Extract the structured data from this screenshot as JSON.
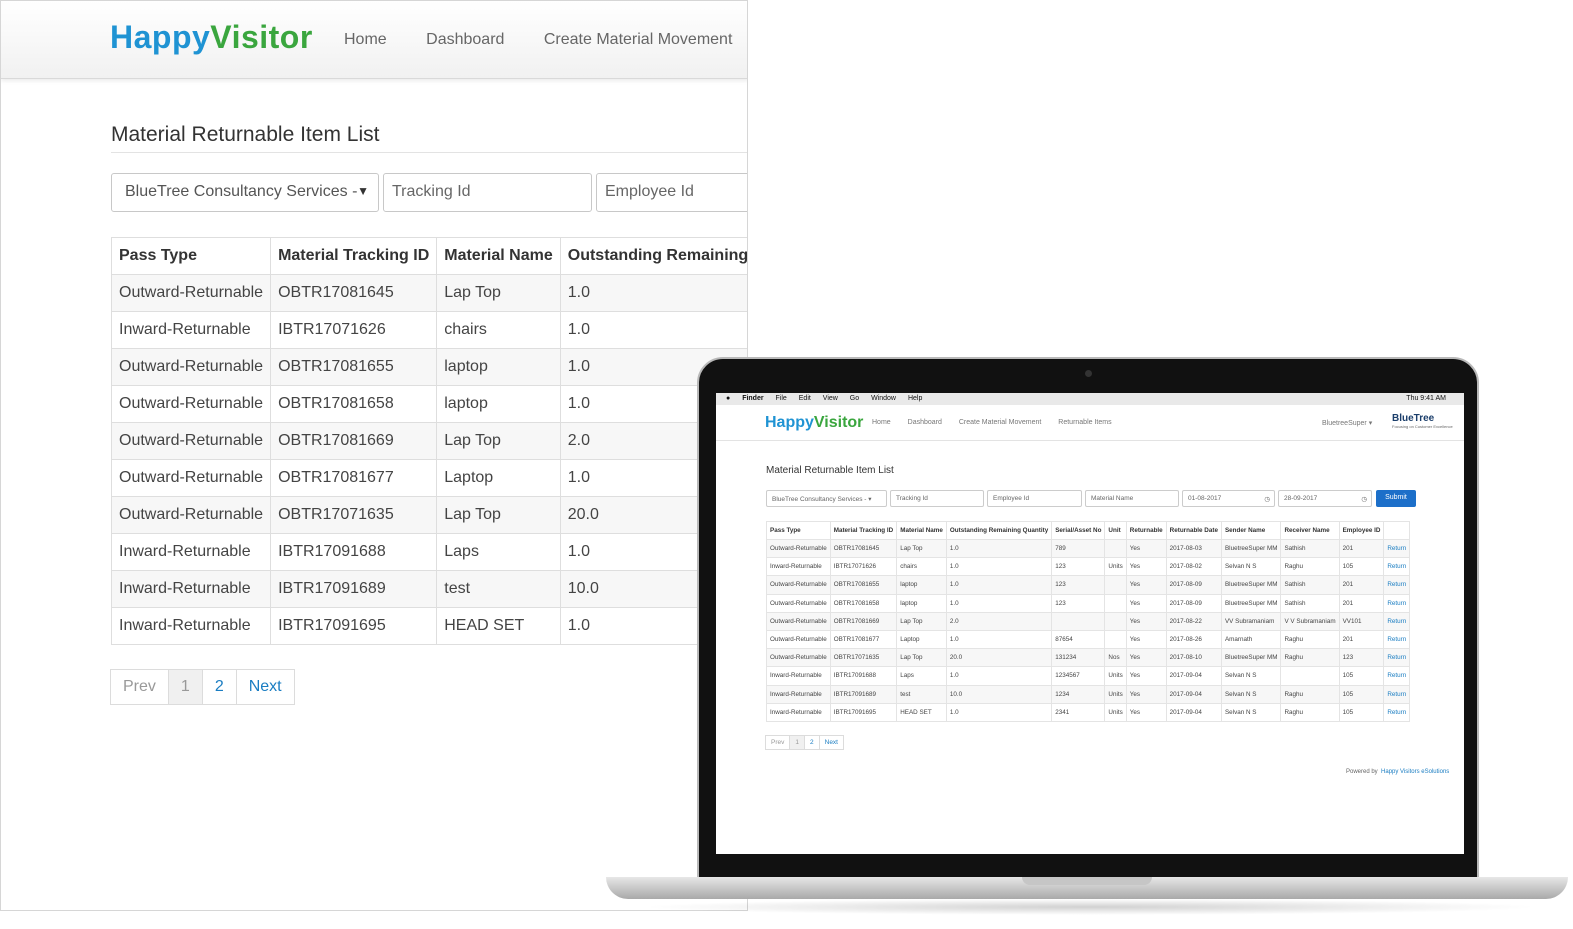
{
  "app": {
    "logo_part1": "Happy",
    "logo_part2": "Visitor"
  },
  "nav": {
    "home": "Home",
    "dashboard": "Dashboard",
    "create": "Create Material Movement",
    "returnable": "Returnable Items"
  },
  "page": {
    "title": "Material Returnable Item List"
  },
  "filters": {
    "company": "BlueTree Consultancy Services -",
    "tracking_placeholder": "Tracking Id",
    "employee_placeholder": "Employee Id",
    "material_placeholder": "Material Name",
    "from_date": "01-08-2017",
    "to_date": "28-09-2017",
    "submit": "Submit"
  },
  "table": {
    "headers": [
      "Pass Type",
      "Material Tracking ID",
      "Material Name",
      "Outstanding Remaining Quantity",
      "Serial/Asset No",
      "Unit",
      "Returnable",
      "Returnable Date",
      "Sender Name",
      "Receiver Name",
      "Employee ID",
      ""
    ],
    "big_header_quantity": "Outstanding Remaining Quant",
    "rows": [
      [
        "Outward-Returnable",
        "OBTR17081645",
        "Lap Top",
        "1.0",
        "789",
        "",
        "Yes",
        "2017-08-03",
        "BluetreeSuper MM",
        "Sathish",
        "201",
        "Return"
      ],
      [
        "Inward-Returnable",
        "IBTR17071626",
        "chairs",
        "1.0",
        "123",
        "Units",
        "Yes",
        "2017-08-02",
        "Selvan N S",
        "Raghu",
        "105",
        "Return"
      ],
      [
        "Outward-Returnable",
        "OBTR17081655",
        "laptop",
        "1.0",
        "123",
        "",
        "Yes",
        "2017-08-09",
        "BluetreeSuper MM",
        "Sathish",
        "201",
        "Return"
      ],
      [
        "Outward-Returnable",
        "OBTR17081658",
        "laptop",
        "1.0",
        "123",
        "",
        "Yes",
        "2017-08-09",
        "BluetreeSuper MM",
        "Sathish",
        "201",
        "Return"
      ],
      [
        "Outward-Returnable",
        "OBTR17081669",
        "Lap Top",
        "2.0",
        "",
        "",
        "Yes",
        "2017-08-22",
        "VV Subramaniam",
        "V V Subramaniam",
        "VV101",
        "Return"
      ],
      [
        "Outward-Returnable",
        "OBTR17081677",
        "Laptop",
        "1.0",
        "87654",
        "",
        "Yes",
        "2017-08-26",
        "Amarnath",
        "Raghu",
        "201",
        "Return"
      ],
      [
        "Outward-Returnable",
        "OBTR17071635",
        "Lap Top",
        "20.0",
        "131234",
        "Nos",
        "Yes",
        "2017-08-10",
        "BluetreeSuper MM",
        "Raghu",
        "123",
        "Return"
      ],
      [
        "Inward-Returnable",
        "IBTR17091688",
        "Laps",
        "1.0",
        "1234567",
        "Units",
        "Yes",
        "2017-09-04",
        "Selvan N S",
        "",
        "105",
        "Return"
      ],
      [
        "Inward-Returnable",
        "IBTR17091689",
        "test",
        "10.0",
        "1234",
        "Units",
        "Yes",
        "2017-09-04",
        "Selvan N S",
        "Raghu",
        "105",
        "Return"
      ],
      [
        "Inward-Returnable",
        "IBTR17091695",
        "HEAD SET",
        "1.0",
        "2341",
        "Units",
        "Yes",
        "2017-09-04",
        "Selvan N S",
        "Raghu",
        "105",
        "Return"
      ]
    ]
  },
  "pagination": {
    "prev": "Prev",
    "page1": "1",
    "page2": "2",
    "next": "Next"
  },
  "laptop": {
    "menubar": [
      "Finder",
      "File",
      "Edit",
      "View",
      "Go",
      "Window",
      "Help"
    ],
    "clock": "Thu 9:41 AM",
    "user": "BluetreeSuper",
    "brand": "BlueTree",
    "brand_tagline": "Focusing on Customer Excellence",
    "powered_label": "Powered by",
    "powered_by": "Happy Visitors eSolutions"
  },
  "colors": {
    "accent": "#1f93d3",
    "logo_green": "#3aa63e",
    "link": "#1a7dc2",
    "submit": "#1c6fc9"
  }
}
